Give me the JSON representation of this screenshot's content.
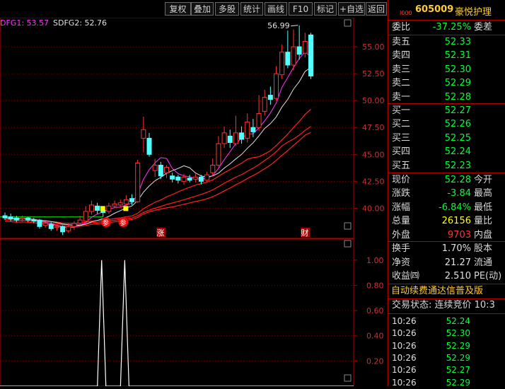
{
  "toolbar": {
    "buttons": [
      "复权",
      "叠加",
      "多股",
      "统计",
      "画线",
      "F10",
      "标记",
      "+自选",
      "返回"
    ]
  },
  "legend": {
    "line1": "DFG1: 53.57",
    "line2": "SDFG2: 52.76"
  },
  "chart_data": {
    "type": "candlestick",
    "price_axis": {
      "ticks": [
        "55.00",
        "52.50",
        "50.00",
        "47.50",
        "45.00",
        "42.50",
        "40.00"
      ],
      "ylim": [
        37.2,
        57.7
      ]
    },
    "high_label": "56.99",
    "markers": [
      "涨",
      "财"
    ],
    "signal_marks": [
      "参",
      "参"
    ],
    "candles": [
      {
        "o": 39.3,
        "c": 39.1,
        "h": 39.6,
        "l": 38.9
      },
      {
        "o": 39.2,
        "c": 39.0,
        "h": 39.5,
        "l": 38.8
      },
      {
        "o": 39.1,
        "c": 38.9,
        "h": 39.3,
        "l": 38.7
      },
      {
        "o": 39.0,
        "c": 39.1,
        "h": 39.3,
        "l": 38.8
      },
      {
        "o": 39.1,
        "c": 38.9,
        "h": 39.2,
        "l": 38.7
      },
      {
        "o": 38.9,
        "c": 38.8,
        "h": 39.1,
        "l": 38.6
      },
      {
        "o": 38.9,
        "c": 38.3,
        "h": 39.0,
        "l": 38.1
      },
      {
        "o": 38.4,
        "c": 38.6,
        "h": 38.8,
        "l": 38.2
      },
      {
        "o": 38.5,
        "c": 38.1,
        "h": 38.7,
        "l": 37.9
      },
      {
        "o": 38.2,
        "c": 38.3,
        "h": 38.5,
        "l": 37.9
      },
      {
        "o": 38.3,
        "c": 37.8,
        "h": 38.4,
        "l": 37.5
      },
      {
        "o": 37.9,
        "c": 38.3,
        "h": 38.6,
        "l": 37.7
      },
      {
        "o": 38.3,
        "c": 38.6,
        "h": 38.8,
        "l": 38.0
      },
      {
        "o": 38.6,
        "c": 38.9,
        "h": 39.3,
        "l": 38.4
      },
      {
        "o": 38.8,
        "c": 39.7,
        "h": 40.2,
        "l": 38.7
      },
      {
        "o": 39.7,
        "c": 40.3,
        "h": 40.7,
        "l": 39.4
      },
      {
        "o": 40.2,
        "c": 39.8,
        "h": 40.5,
        "l": 39.5
      },
      {
        "o": 39.8,
        "c": 39.6,
        "h": 40.1,
        "l": 39.2
      },
      {
        "o": 39.7,
        "c": 40.2,
        "h": 40.5,
        "l": 39.5
      },
      {
        "o": 40.2,
        "c": 40.4,
        "h": 40.7,
        "l": 40.0
      },
      {
        "o": 40.3,
        "c": 40.5,
        "h": 40.8,
        "l": 40.1
      },
      {
        "o": 40.4,
        "c": 40.8,
        "h": 41.2,
        "l": 40.2
      },
      {
        "o": 40.9,
        "c": 40.6,
        "h": 41.3,
        "l": 40.3
      },
      {
        "o": 40.6,
        "c": 44.2,
        "h": 44.5,
        "l": 40.5
      },
      {
        "o": 46.5,
        "c": 47.3,
        "h": 48.5,
        "l": 45.2
      },
      {
        "o": 46.5,
        "c": 45.0,
        "h": 47.0,
        "l": 44.8
      },
      {
        "o": 43.5,
        "c": 44.0,
        "h": 44.6,
        "l": 42.9
      },
      {
        "o": 44.0,
        "c": 43.0,
        "h": 44.3,
        "l": 42.7
      },
      {
        "o": 43.3,
        "c": 43.8,
        "h": 44.0,
        "l": 42.8
      },
      {
        "o": 43.0,
        "c": 42.7,
        "h": 43.3,
        "l": 42.4
      },
      {
        "o": 42.9,
        "c": 42.6,
        "h": 43.1,
        "l": 42.3
      },
      {
        "o": 42.5,
        "c": 42.9,
        "h": 43.2,
        "l": 42.2
      },
      {
        "o": 42.8,
        "c": 42.6,
        "h": 43.1,
        "l": 42.4
      },
      {
        "o": 42.7,
        "c": 42.9,
        "h": 43.2,
        "l": 42.4
      },
      {
        "o": 42.9,
        "c": 42.5,
        "h": 43.1,
        "l": 42.2
      },
      {
        "o": 42.6,
        "c": 43.1,
        "h": 43.4,
        "l": 42.4
      },
      {
        "o": 43.3,
        "c": 44.0,
        "h": 44.6,
        "l": 43.0
      },
      {
        "o": 44.0,
        "c": 46.0,
        "h": 46.7,
        "l": 43.8
      },
      {
        "o": 46.0,
        "c": 47.0,
        "h": 47.6,
        "l": 45.6
      },
      {
        "o": 46.7,
        "c": 46.1,
        "h": 47.3,
        "l": 45.6
      },
      {
        "o": 46.0,
        "c": 47.0,
        "h": 48.6,
        "l": 45.8
      },
      {
        "o": 47.0,
        "c": 46.4,
        "h": 47.6,
        "l": 46.0
      },
      {
        "o": 46.5,
        "c": 48.0,
        "h": 48.8,
        "l": 46.1
      },
      {
        "o": 47.5,
        "c": 47.1,
        "h": 48.3,
        "l": 46.6
      },
      {
        "o": 47.5,
        "c": 48.8,
        "h": 50.5,
        "l": 47.2
      },
      {
        "o": 49.0,
        "c": 50.3,
        "h": 51.0,
        "l": 48.6
      },
      {
        "o": 50.5,
        "c": 50.1,
        "h": 51.3,
        "l": 49.6
      },
      {
        "o": 50.2,
        "c": 52.5,
        "h": 53.2,
        "l": 50.0
      },
      {
        "o": 52.4,
        "c": 54.5,
        "h": 55.2,
        "l": 52.0
      },
      {
        "o": 54.5,
        "c": 53.3,
        "h": 56.5,
        "l": 53.0
      },
      {
        "o": 53.3,
        "c": 55.0,
        "h": 56.6,
        "l": 52.8
      },
      {
        "o": 55.0,
        "c": 54.3,
        "h": 56.99,
        "l": 53.8
      },
      {
        "o": 54.4,
        "c": 55.5,
        "h": 56.3,
        "l": 54.0
      },
      {
        "o": 56.1,
        "c": 52.28,
        "h": 56.3,
        "l": 52.0
      }
    ],
    "indicator": {
      "ticks": [
        "1.00",
        "0.80",
        "0.60",
        "0.40",
        "0.20"
      ],
      "ylim": [
        0.0,
        1.1
      ],
      "values": [
        0,
        0,
        0,
        0,
        0,
        0,
        0,
        0,
        0,
        0,
        0,
        0,
        0,
        0,
        0,
        0,
        0,
        0,
        0,
        0,
        0,
        0,
        0,
        0,
        0,
        0,
        0,
        0,
        0,
        0,
        0,
        0,
        0,
        0,
        0,
        0,
        0,
        0,
        0,
        0,
        0,
        0,
        0,
        0,
        0,
        0,
        0,
        0,
        0,
        0,
        0,
        0,
        0,
        0
      ]
    }
  },
  "stock": {
    "code": "605009",
    "name": "豪悦护理",
    "prefix": "I000"
  },
  "ratio": {
    "label": "委比",
    "value": "-37.25%",
    "extra": "委差"
  },
  "sell": [
    {
      "label": "卖五",
      "price": "52.33"
    },
    {
      "label": "卖四",
      "price": "52.31"
    },
    {
      "label": "卖三",
      "price": "52.30"
    },
    {
      "label": "卖二",
      "price": "52.29"
    },
    {
      "label": "卖一",
      "price": "52.28"
    }
  ],
  "buy": [
    {
      "label": "买一",
      "price": "52.27"
    },
    {
      "label": "买二",
      "price": "52.26"
    },
    {
      "label": "买三",
      "price": "52.25"
    },
    {
      "label": "买四",
      "price": "52.24"
    },
    {
      "label": "买五",
      "price": "52.23"
    }
  ],
  "quote": [
    {
      "label": "现价",
      "value": "52.28",
      "extra": "今开",
      "color": "g"
    },
    {
      "label": "涨跌",
      "value": "-3.84",
      "extra": "最高",
      "color": "g"
    },
    {
      "label": "涨幅",
      "value": "-6.84%",
      "extra": "最低",
      "color": "g"
    },
    {
      "label": "总量",
      "value": "26156",
      "extra": "量比",
      "color": "y"
    },
    {
      "label": "外盘",
      "value": "9703",
      "extra": "内盘",
      "color": "r"
    }
  ],
  "stats": [
    {
      "label": "换手",
      "value": "1.70%",
      "extra": "股本"
    },
    {
      "label": "净资",
      "value": "21.27",
      "extra": "流通"
    },
    {
      "label": "收益㈣",
      "value": "2.510",
      "extra": "PE(动)"
    }
  ],
  "notice": "自动续费通达信普及版",
  "trade_status": "交易状态: 连续竞价 10:3",
  "ticks": [
    {
      "time": "10:26",
      "price": "52.24"
    },
    {
      "time": "10:26",
      "price": "52.30"
    },
    {
      "time": "10:26",
      "price": "52.29"
    },
    {
      "time": "10:26",
      "price": "52.29"
    },
    {
      "time": "10:26",
      "price": "52.27"
    },
    {
      "time": "10:26",
      "price": "52.29"
    }
  ]
}
